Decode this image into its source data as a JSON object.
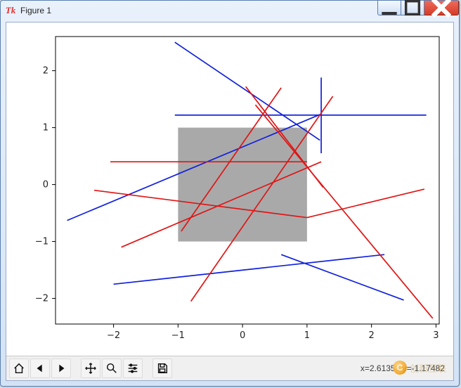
{
  "window": {
    "title": "Figure 1",
    "app_icon_label": "Tk"
  },
  "toolbar": {
    "home": "Home",
    "back": "Back",
    "forward": "Forward",
    "pan": "Pan",
    "zoom": "Zoom",
    "configure": "Configure subplots",
    "save": "Save"
  },
  "status": {
    "coord_readout": "x=2.61353   y=-1.17482"
  },
  "watermark": {
    "badge": "C",
    "text": "创新互联"
  },
  "chart_data": {
    "type": "line",
    "title": "",
    "xlabel": "",
    "ylabel": "",
    "xlim": [
      -2.9,
      3.05
    ],
    "ylim": [
      -2.45,
      2.6
    ],
    "xticks": [
      -2,
      -1,
      0,
      1,
      2,
      3
    ],
    "yticks": [
      -2,
      -1,
      0,
      1,
      2
    ],
    "patches": [
      {
        "shape": "rect",
        "x0": -1.0,
        "y0": -1.0,
        "x1": 1.0,
        "y1": 1.0,
        "color": "#a9a9a9"
      }
    ],
    "segments": [
      {
        "x0": -1.05,
        "y0": 2.5,
        "x1": 1.2,
        "y1": 0.78,
        "color": "blue"
      },
      {
        "x0": -2.72,
        "y0": -0.63,
        "x1": 1.2,
        "y1": 1.23,
        "color": "blue"
      },
      {
        "x0": -1.05,
        "y0": 1.22,
        "x1": 2.85,
        "y1": 1.22,
        "color": "blue"
      },
      {
        "x0": 1.22,
        "y0": 1.88,
        "x1": 1.22,
        "y1": 0.55,
        "color": "blue"
      },
      {
        "x0": -2.0,
        "y0": -1.75,
        "x1": 2.2,
        "y1": -1.23,
        "color": "blue"
      },
      {
        "x0": 0.6,
        "y0": -1.23,
        "x1": 2.5,
        "y1": -2.03,
        "color": "blue"
      },
      {
        "x0": -0.95,
        "y0": -0.82,
        "x1": 0.6,
        "y1": 1.7,
        "color": "red"
      },
      {
        "x0": -2.05,
        "y0": 0.4,
        "x1": 1.0,
        "y1": 0.4,
        "color": "red"
      },
      {
        "x0": -2.3,
        "y0": -0.1,
        "x1": 1.0,
        "y1": -0.58,
        "color": "red"
      },
      {
        "x0": 1.0,
        "y0": -0.58,
        "x1": 2.82,
        "y1": -0.08,
        "color": "red"
      },
      {
        "x0": 0.05,
        "y0": 1.72,
        "x1": 1.25,
        "y1": -0.05,
        "color": "red"
      },
      {
        "x0": -1.88,
        "y0": -1.1,
        "x1": 1.22,
        "y1": 0.4,
        "color": "red"
      },
      {
        "x0": 0.2,
        "y0": 1.4,
        "x1": 2.95,
        "y1": -2.35,
        "color": "red"
      },
      {
        "x0": -0.8,
        "y0": -2.05,
        "x1": 1.4,
        "y1": 1.55,
        "color": "red"
      }
    ]
  }
}
